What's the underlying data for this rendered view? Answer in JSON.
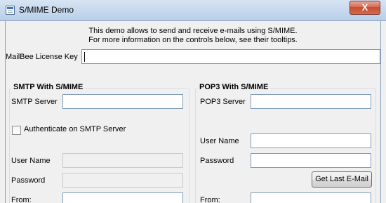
{
  "window": {
    "title": "S/MIME Demo",
    "close_label": "X"
  },
  "intro": {
    "line1": "This demo allows to send and receive e-mails using S/MIME.",
    "line2": "For more information on the controls below, see their tooltips."
  },
  "license": {
    "label": "MailBee License Key",
    "value": ""
  },
  "smtp": {
    "title": "SMTP With S/MIME",
    "server_label": "SMTP Server",
    "server_value": "",
    "auth_label": "Authenticate on SMTP Server",
    "auth_checked": false,
    "username_label": "User Name",
    "username_value": "",
    "password_label": "Password",
    "password_value": "",
    "from_label": "From:",
    "from_value": ""
  },
  "pop3": {
    "title": "POP3 With S/MIME",
    "server_label": "POP3 Server",
    "server_value": "",
    "username_label": "User Name",
    "username_value": "",
    "password_label": "Password",
    "password_value": "",
    "get_last_label": "Get Last E-Mail",
    "from_label": "From:",
    "from_value": ""
  }
}
